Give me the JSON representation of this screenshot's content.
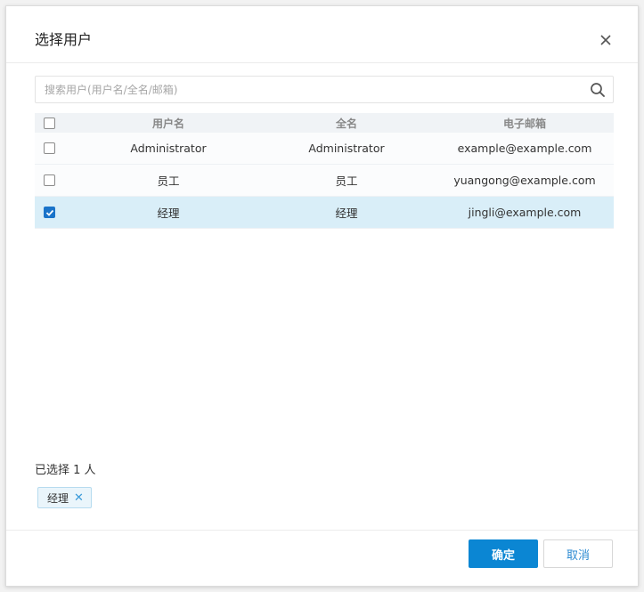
{
  "dialog": {
    "title": "选择用户"
  },
  "search": {
    "placeholder": "搜索用户(用户名/全名/邮箱)",
    "value": ""
  },
  "table": {
    "headers": {
      "username": "用户名",
      "fullname": "全名",
      "email": "电子邮箱"
    },
    "rows": [
      {
        "username": "Administrator",
        "fullname": "Administrator",
        "email": "example@example.com",
        "checked": false
      },
      {
        "username": "员工",
        "fullname": "员工",
        "email": "yuangong@example.com",
        "checked": false
      },
      {
        "username": "经理",
        "fullname": "经理",
        "email": "jingli@example.com",
        "checked": true
      }
    ]
  },
  "selection": {
    "summary": "已选择 1 人",
    "tags": [
      "经理"
    ]
  },
  "buttons": {
    "ok": "确定",
    "cancel": "取消"
  },
  "colors": {
    "primary": "#0b86d3",
    "selected_row": "#d9eef8",
    "tag_bg": "#eaf5fb"
  }
}
